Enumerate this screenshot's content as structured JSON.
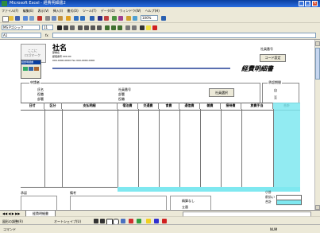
{
  "app": {
    "title": "Microsoft Excel - 経費明細書2"
  },
  "menu": [
    "ファイル(F)",
    "編集(E)",
    "表示(V)",
    "挿入(I)",
    "書式(O)",
    "ツール(T)",
    "データ(D)",
    "ウィンドウ(W)",
    "ヘルプ(H)"
  ],
  "toolbar": {
    "zoom": "100%",
    "font_name": "MS Pゴシック",
    "font_size": "11"
  },
  "formula": {
    "namebox": "A1",
    "value": ""
  },
  "colors": {
    "accent_cyan": "#7fe8f0",
    "title_blue": "#0a3fa0",
    "ribbon_line": "#5a6fb0"
  },
  "sheet": {
    "company": "社名",
    "company_sub1": "部署名",
    "company_sub2": "郵便番号 000-00",
    "company_sub3": "000-0000-0000 Fax 000-0000-0000",
    "logo_line1": "ここに",
    "logo_line2": "ロゴマーク",
    "small_panel_title": "経費明細書",
    "approval_label": "社員番号",
    "setting_button": "コード設定",
    "doc_title": "経費明細書",
    "applicant_box": "申請者",
    "applicant_fields": [
      "氏名",
      "役職",
      "部署"
    ],
    "employee_fields": [
      "社員番号",
      "部署",
      "役職"
    ],
    "select_button": "社員選択",
    "approval_box": "承認期間",
    "approval_fields": [
      "自",
      "至"
    ],
    "columns": [
      "日付",
      "区分",
      "支払明細",
      "宿泊費",
      "交通費",
      "食費",
      "通信費",
      "雑費",
      "接待費",
      "旅費手当",
      "合計"
    ],
    "footer_left_label": "承認",
    "footer_mid_label": "備考",
    "footer_mid_options": [
      "精算なし",
      "立替"
    ],
    "summary_labels": [
      "小計",
      "前払い",
      "合計"
    ]
  },
  "tabs": [
    "経費明細書"
  ],
  "drawbar": {
    "label": "図形の調整(R)",
    "autoshape": "オートシェイプ(U)"
  },
  "status": {
    "left": "コマンド",
    "right": "NUM"
  }
}
